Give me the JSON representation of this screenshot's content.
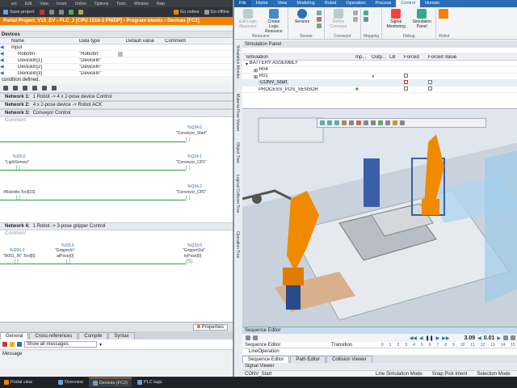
{
  "tia": {
    "menu": [
      "ect",
      "Edit",
      "View",
      "Insert",
      "Online",
      "Options",
      "Tools",
      "Window",
      "Help"
    ],
    "toolbar": {
      "save": "Save project",
      "go_online": "Go online",
      "go_offline": "Go offline"
    },
    "path": "Portal Project_V15_EV  ›  PLC_2 [CPU 1516-3 PN/DP]  ›  Program blocks  ›  Devices [FC2]",
    "devices_header": "Devices",
    "columns": {
      "name": "Name",
      "datatype": "Data type",
      "default": "Default value",
      "comment": "Comment"
    },
    "rows": [
      {
        "name": "Input",
        "type": "",
        "level": 0
      },
      {
        "name": "RobotIn",
        "type": "\"RobotIn\"",
        "level": 1
      },
      {
        "name": "DeviceIn[1]",
        "type": "\"DeviceIn\"",
        "level": 1
      },
      {
        "name": "DeviceIn[2]",
        "type": "\"DeviceIn\"",
        "level": 1
      },
      {
        "name": "DeviceIn[3]",
        "type": "\"DeviceIn\"",
        "level": 1
      }
    ],
    "condition": "condition defined.",
    "networks": [
      {
        "label": "Network 1:",
        "title": "1 Robot -> 4 x 2-pose device Control"
      },
      {
        "label": "Network 2:",
        "title": "4 x 2-pose device -> Robot ACK"
      },
      {
        "label": "Network 3:",
        "title": "Conveyor Control"
      },
      {
        "label": "Network 4:",
        "title": "1 Robot -> 3-pose gripper Control"
      }
    ],
    "comment_label": "Comment",
    "ladder": {
      "q340": "%Q34.0",
      "conv_start": "\"Conveyor_Start\"",
      "i200": "%I20.0",
      "lightsensor": "\"LightSensor\"",
      "q341": "%Q34.1",
      "conv_cp1": "\"Conveyor_CP1\"",
      "robotin_tool": "#RobotIn.Tool[16]",
      "q342": "%Q34.2",
      "conv_cp2": "\"Conveyor_CP2\"",
      "i2000": "%I200.0",
      "r001": "\"R001_IN\".Tool[5]",
      "i330": "%I33.0",
      "gripperin": "\"GripperIn\".",
      "atpose": "atPose[0]",
      "q330": "%Q33.0",
      "gripperout": "\"GripperOut\".",
      "topose": "toPose[0]"
    },
    "properties": "Properties",
    "bottom_tabs": [
      "General",
      "Cross-references",
      "Compile",
      "Syntax"
    ],
    "filter": "Show all messages",
    "message_col": "Message"
  },
  "sim": {
    "ribbon_tabs": [
      "File",
      "Home",
      "View",
      "Modeling",
      "Robot",
      "Operation",
      "Process",
      "Control",
      "Human"
    ],
    "active_tab": "Control",
    "groups": {
      "resource": {
        "label": "Resource",
        "btns": [
          "Edit Logic Resource",
          "Create Logic Resource"
        ]
      },
      "sensor": {
        "label": "Sensor",
        "btns": [
          "Sensors"
        ]
      },
      "conveyor": {
        "label": "Conveyor",
        "btns": [
          "Define Conveyor"
        ]
      },
      "mapping": {
        "label": "Mapping",
        "btns": []
      },
      "debug": {
        "label": "Debug",
        "btns": [
          "Signal Monitoring",
          "Simulation Panel"
        ]
      },
      "robot": {
        "label": "Robot",
        "btns": []
      }
    },
    "sim_panel_title": "Simulation Panel",
    "sim_cols": {
      "simulation": "Simulation",
      "inp": "Inp...",
      "outp": "Outp...",
      "lb": "LB",
      "forced": "Forced",
      "forced_value": "Forced Value"
    },
    "sim_rows": [
      "BATTERY ASSEMBLY",
      "R04",
      "R01",
      "CONV_Start",
      "PROCESS_POS_SENSOR"
    ],
    "side_labels": [
      "Simulation Monitor",
      "Material Flow Viewer",
      "Object Tree",
      "Logical Collision Tree",
      "Operation Tree"
    ],
    "seq_title": "Sequence Editor",
    "seq_time": "3.09",
    "seq_step": "0.01",
    "seq_cols": {
      "editor": "Sequence Editor",
      "transition": "Transition"
    },
    "seq_item": "LineOperation",
    "ticks": [
      "0",
      "1",
      "2",
      "3",
      "4",
      "5",
      "6",
      "7",
      "8",
      "9",
      "10",
      "11",
      "12",
      "13",
      "14",
      "15"
    ],
    "bottom_tabs": [
      "Sequence Editor",
      "Path Editor",
      "Collision Viewer"
    ],
    "signal_viewer": "Signal Viewer",
    "status_left": "CONV_Start",
    "status_right": [
      "Line Simulation Mode",
      "Snap Pick Intent",
      "Selection Mode"
    ]
  },
  "taskbar": [
    "Portal view",
    "Overview",
    "Devices (FC2)",
    "PLC tags"
  ]
}
